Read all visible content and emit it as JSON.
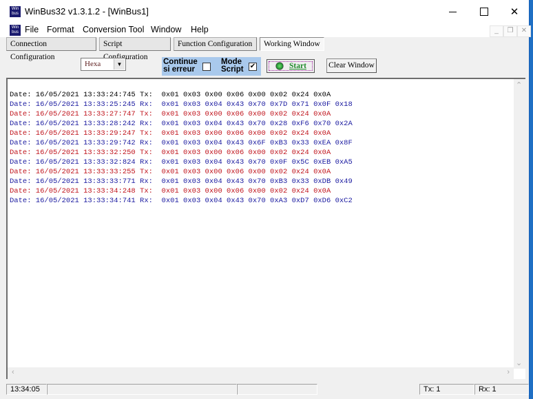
{
  "window": {
    "title": "WinBus32 v1.3.1.2  - [WinBus1]",
    "app_icon_text": "Win bus"
  },
  "menu": {
    "items": [
      "File",
      "Format",
      "Conversion Tool",
      "Window",
      "Help"
    ]
  },
  "tabs": [
    {
      "label": "Connection Configuration",
      "active": false
    },
    {
      "label": "Script Configuration",
      "active": false
    },
    {
      "label": "Function Configuration",
      "active": false
    },
    {
      "label": "Working Window",
      "active": true
    }
  ],
  "toolbar": {
    "format_select": "Hexa",
    "continue_on_error_label_1": "Continue",
    "continue_on_error_label_2": "si erreur",
    "continue_on_error_checked": false,
    "mode_script_label_1": "Mode",
    "mode_script_label_2": "Script",
    "mode_script_checked": true,
    "mode_script_check_glyph": "✔",
    "start_label": "Start",
    "clear_label": "Clear Window"
  },
  "log": [
    {
      "date": "16/05/2021",
      "time": "13:33:24:745",
      "dir": "Tx:",
      "bytes": [
        "0x01",
        "0x03",
        "0x00",
        "0x06",
        "0x00",
        "0x02",
        "0x24",
        "0x0A"
      ]
    },
    {
      "date": "16/05/2021",
      "time": "13:33:25:245",
      "dir": "Rx:",
      "bytes": [
        "0x01",
        "0x03",
        "0x04",
        "0x43",
        "0x70",
        "0x7D",
        "0x71",
        "0x0F",
        "0x18"
      ]
    },
    {
      "date": "16/05/2021",
      "time": "13:33:27:747",
      "dir": "Tx:",
      "bytes": [
        "0x01",
        "0x03",
        "0x00",
        "0x06",
        "0x00",
        "0x02",
        "0x24",
        "0x0A"
      ]
    },
    {
      "date": "16/05/2021",
      "time": "13:33:28:242",
      "dir": "Rx:",
      "bytes": [
        "0x01",
        "0x03",
        "0x04",
        "0x43",
        "0x70",
        "0x28",
        "0xF6",
        "0x70",
        "0x2A"
      ]
    },
    {
      "date": "16/05/2021",
      "time": "13:33:29:247",
      "dir": "Tx:",
      "bytes": [
        "0x01",
        "0x03",
        "0x00",
        "0x06",
        "0x00",
        "0x02",
        "0x24",
        "0x0A"
      ]
    },
    {
      "date": "16/05/2021",
      "time": "13:33:29:742",
      "dir": "Rx:",
      "bytes": [
        "0x01",
        "0x03",
        "0x04",
        "0x43",
        "0x6F",
        "0xB3",
        "0x33",
        "0xEA",
        "0x8F"
      ]
    },
    {
      "date": "16/05/2021",
      "time": "13:33:32:250",
      "dir": "Tx:",
      "bytes": [
        "0x01",
        "0x03",
        "0x00",
        "0x06",
        "0x00",
        "0x02",
        "0x24",
        "0x0A"
      ]
    },
    {
      "date": "16/05/2021",
      "time": "13:33:32:824",
      "dir": "Rx:",
      "bytes": [
        "0x01",
        "0x03",
        "0x04",
        "0x43",
        "0x70",
        "0x0F",
        "0x5C",
        "0xEB",
        "0xA5"
      ]
    },
    {
      "date": "16/05/2021",
      "time": "13:33:33:255",
      "dir": "Tx:",
      "bytes": [
        "0x01",
        "0x03",
        "0x00",
        "0x06",
        "0x00",
        "0x02",
        "0x24",
        "0x0A"
      ]
    },
    {
      "date": "16/05/2021",
      "time": "13:33:33:771",
      "dir": "Rx:",
      "bytes": [
        "0x01",
        "0x03",
        "0x04",
        "0x43",
        "0x70",
        "0xB3",
        "0x33",
        "0xDB",
        "0x49"
      ]
    },
    {
      "date": "16/05/2021",
      "time": "13:33:34:248",
      "dir": "Tx:",
      "bytes": [
        "0x01",
        "0x03",
        "0x00",
        "0x06",
        "0x00",
        "0x02",
        "0x24",
        "0x0A"
      ]
    },
    {
      "date": "16/05/2021",
      "time": "13:33:34:741",
      "dir": "Rx:",
      "bytes": [
        "0x01",
        "0x03",
        "0x04",
        "0x43",
        "0x70",
        "0xA3",
        "0xD7",
        "0xD6",
        "0xC2"
      ]
    }
  ],
  "log_prefix": "Date:",
  "colors": {
    "tx": "#c0141c",
    "rx": "#1a1aa0",
    "first_line": "#000000",
    "option_panel": "#a9c9ec",
    "start_text": "#1e8a2a"
  },
  "statusbar": {
    "clock": "13:34:05",
    "tx_count": "Tx: 1",
    "rx_count": "Rx: 1"
  }
}
